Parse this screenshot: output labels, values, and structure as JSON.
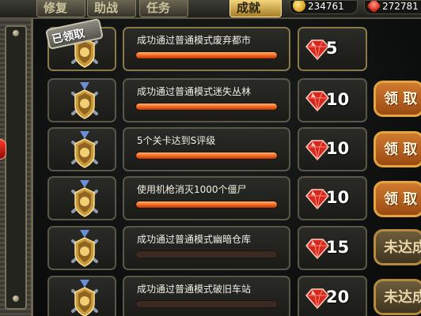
{
  "tabs": [
    "修复",
    "助战",
    "任务",
    "成就"
  ],
  "resources": {
    "gold": "234761",
    "gems": "272781"
  },
  "claimed_label": "已领取",
  "colors": {
    "accent": "#f0651e",
    "gem": "#d6271d",
    "button_border": "#e4a441"
  },
  "tasks": [
    {
      "name": "成功通过普通模式废弃都市",
      "progress": 1.0,
      "reward": "5",
      "claimed": true,
      "button": ""
    },
    {
      "name": "成功通过普通模式迷失丛林",
      "progress": 1.0,
      "reward": "10",
      "claimed": false,
      "button": "领 取"
    },
    {
      "name": "5个关卡达到S评级",
      "progress": 1.0,
      "reward": "10",
      "claimed": false,
      "button": "领 取"
    },
    {
      "name": "使用机枪消灭1000个僵尸",
      "progress": 1.0,
      "reward": "10",
      "claimed": false,
      "button": "领 取"
    },
    {
      "name": "成功通过普通模式幽暗仓库",
      "progress": 0.0,
      "reward": "15",
      "claimed": false,
      "button": "未达成"
    },
    {
      "name": "成功通过普通模式破旧车站",
      "progress": 0.0,
      "reward": "20",
      "claimed": false,
      "button": "未达成"
    }
  ]
}
